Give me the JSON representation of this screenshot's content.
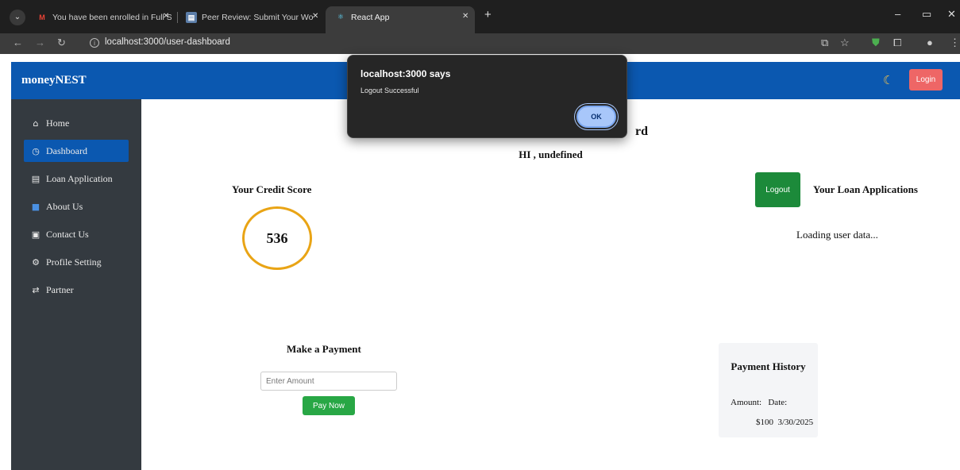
{
  "browser": {
    "tabs": [
      {
        "title": "You have been enrolled in Full S",
        "favicon": "gmail-icon"
      },
      {
        "title": "Peer Review: Submit Your Work",
        "favicon": "course-icon"
      },
      {
        "title": "React App",
        "favicon": "react-icon",
        "active": true
      }
    ],
    "url": "localhost:3000/user-dashboard"
  },
  "app": {
    "brand": "moneyNEST",
    "login_label": "Login",
    "sidebar": [
      {
        "label": "Home",
        "icon": "home-icon"
      },
      {
        "label": "Dashboard",
        "icon": "gauge-icon",
        "active": true
      },
      {
        "label": "Loan Application",
        "icon": "form-icon"
      },
      {
        "label": "About Us",
        "icon": "info-icon"
      },
      {
        "label": "Contact Us",
        "icon": "contact-icon"
      },
      {
        "label": "Profile Setting",
        "icon": "settings-icon"
      },
      {
        "label": "Partner",
        "icon": "handshake-icon"
      }
    ],
    "dashboard_title_visible": "rd",
    "greeting": "HI , undefined",
    "credit": {
      "title": "Your Credit Score",
      "score": "536"
    },
    "logout_label": "Logout",
    "loans": {
      "title": "Your Loan Applications",
      "status": "Loading user data..."
    },
    "payment": {
      "title": "Make a Payment",
      "placeholder": "Enter Amount",
      "button": "Pay Now"
    },
    "history": {
      "title": "Payment History",
      "header": "Amount:   Date:",
      "rows": [
        {
          "amount": "$100",
          "date": "3/30/2025"
        }
      ]
    }
  },
  "dialog": {
    "title": "localhost:3000 says",
    "message": "Logout Successful",
    "ok_label": "OK"
  },
  "colors": {
    "header": "#0b58b0",
    "sidebar": "#343a40",
    "login_button": "#ee6666",
    "logout_button": "#1c8a3a",
    "pay_button": "#28a745",
    "credit_ring": "#e9a415"
  }
}
